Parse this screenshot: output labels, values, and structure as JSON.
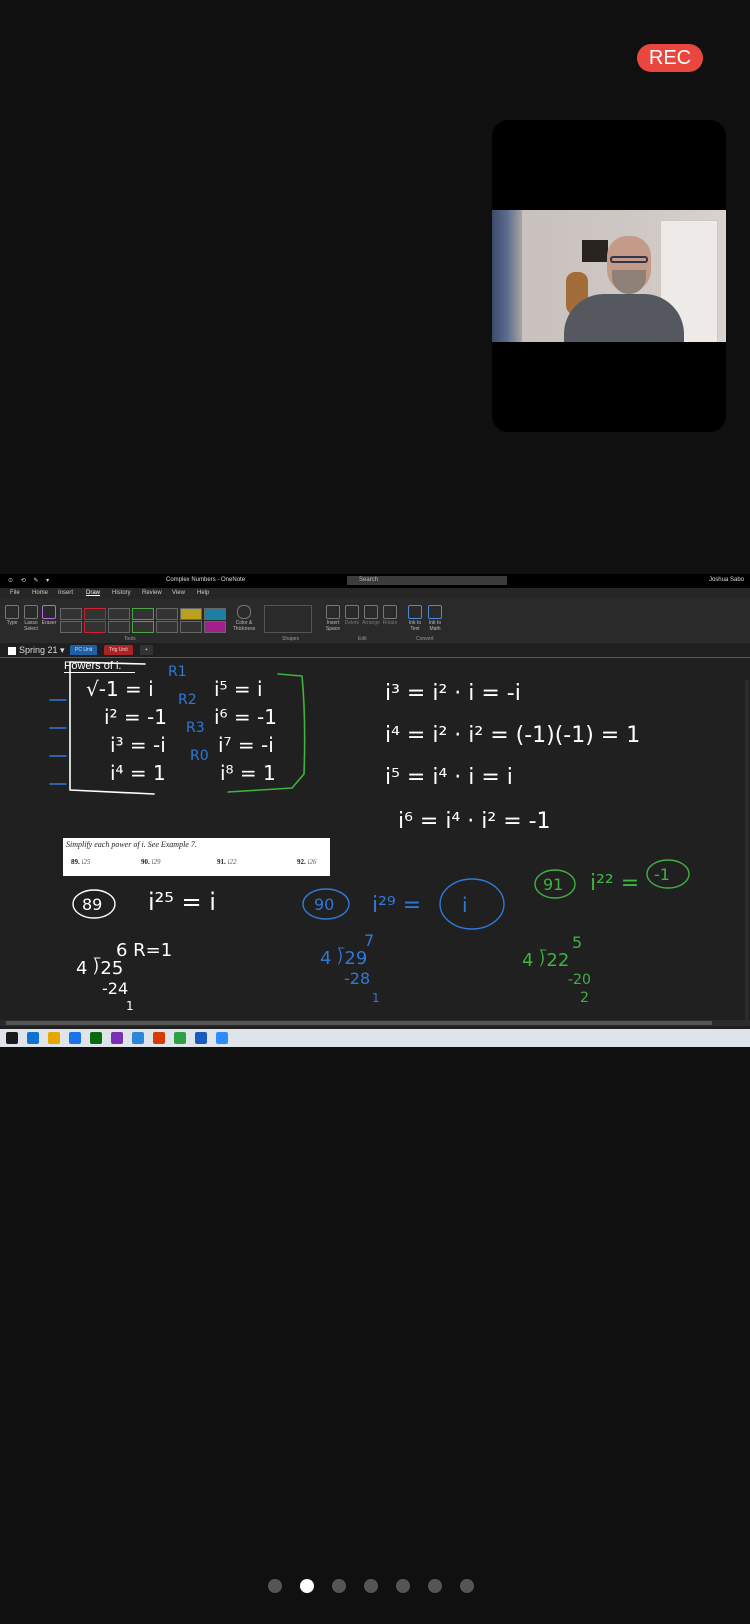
{
  "zoom_meeting": {
    "recording_badge": "REC",
    "page_indicator": {
      "count": 7,
      "active": 2
    }
  },
  "onenote": {
    "window_title": "Complex Numbers - OneNote",
    "search_placeholder": "Search",
    "user_name": "Joshua Sabo",
    "menu_tabs": [
      "File",
      "Home",
      "Insert",
      "Draw",
      "History",
      "Review",
      "View",
      "Help"
    ],
    "active_menu_tab": "Draw",
    "ribbon": {
      "type_label": "Type",
      "lasso_label": "Lasso\nSelect",
      "eraser_label": "Eraser",
      "color_thickness_label": "Color &\nThickness",
      "insert_space_label": "Insert\nSpace",
      "delete_label": "Delete",
      "arrange_label": "Arrange",
      "rotate_label": "Rotate",
      "ink_to_text_label": "Ink to\nText",
      "ink_to_math_label": "Ink to\nMath",
      "group_tools": "Tools",
      "group_shapes": "Shapes",
      "group_edit": "Edit",
      "group_convert": "Convert"
    },
    "notebook_name": "Spring 21",
    "section_tabs": [
      {
        "label": "PC Unit",
        "color": "#1f5fa8"
      },
      {
        "label": "Trig Unit",
        "color": "#a82323"
      },
      {
        "label": "+",
        "color": "#333333"
      }
    ],
    "page_title": "Powers of i.",
    "exercise": {
      "instruction": "Simplify each power of i. See Example 7.",
      "items": [
        {
          "num": "89.",
          "expr": "i25"
        },
        {
          "num": "90.",
          "expr": "i29"
        },
        {
          "num": "91.",
          "expr": "i22"
        },
        {
          "num": "92.",
          "expr": "i26"
        }
      ]
    },
    "taskbar_icon_colors": [
      "#1a1a1a",
      "#0d72d1",
      "#e7a600",
      "#1a73e8",
      "#0b6a0b",
      "#7b2fb3",
      "#2b88d8",
      "#d83b01",
      "#2f9e44",
      "#185abd",
      "#2d8cff"
    ]
  },
  "ink": {
    "white": "#ffffff",
    "blue": "#2f78d6",
    "green": "#3fb23f"
  }
}
